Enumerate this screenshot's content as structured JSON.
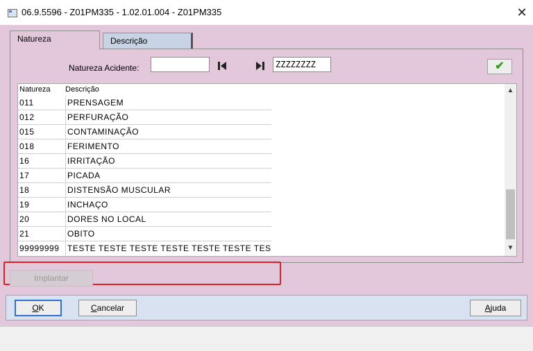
{
  "window": {
    "title": "06.9.5596 - Z01PM335 - 1.02.01.004 - Z01PM335",
    "close_glyph": "✕"
  },
  "tabs": [
    {
      "label": "Natureza",
      "active": true
    },
    {
      "label": "Descrição",
      "active": false
    }
  ],
  "filter": {
    "label": "Natureza Acidente:",
    "start_value": "",
    "end_value": "ZZZZZZZZ",
    "first_icon": "skip-first-icon",
    "last_icon": "skip-last-icon",
    "confirm_icon": "checkmark-icon"
  },
  "grid": {
    "columns": [
      "Natureza",
      "Descrição"
    ],
    "rows": [
      {
        "code": "011",
        "desc": "PRENSAGEM"
      },
      {
        "code": "012",
        "desc": "PERFURAÇÃO"
      },
      {
        "code": "015",
        "desc": "CONTAMINAÇÃO"
      },
      {
        "code": "018",
        "desc": "FERIMENTO"
      },
      {
        "code": "16",
        "desc": "IRRITAÇÃO"
      },
      {
        "code": "17",
        "desc": "PICADA"
      },
      {
        "code": "18",
        "desc": "DISTENSÃO MUSCULAR"
      },
      {
        "code": "19",
        "desc": "INCHAÇO"
      },
      {
        "code": "20",
        "desc": "DORES NO LOCAL"
      },
      {
        "code": "21",
        "desc": "OBITO"
      },
      {
        "code": "99999999",
        "desc": "TESTE TESTE TESTE TESTE TESTE TESTE TESTE"
      }
    ]
  },
  "buttons": {
    "implantar": "Implantar",
    "ok_mnemonic": "O",
    "ok_rest": "K",
    "cancel_mnemonic": "C",
    "cancel_rest": "ancelar",
    "help_mnemonic": "A",
    "help_rest": "juda"
  },
  "colors": {
    "window_bg": "#e3c8dc",
    "tab_inactive": "#c8d3e6",
    "button_bar": "#d9e2f1",
    "highlight": "#e02020",
    "confirm": "#3a9a1a"
  }
}
